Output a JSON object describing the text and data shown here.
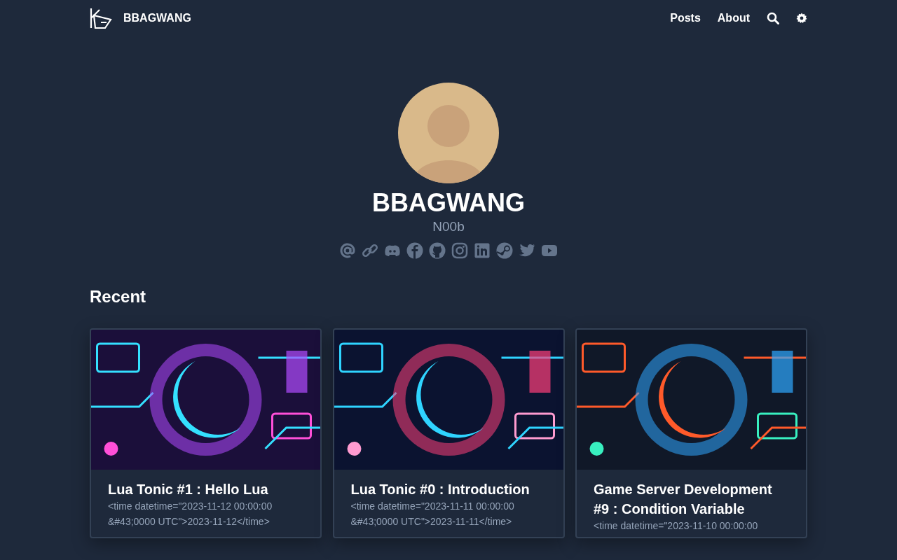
{
  "navbar": {
    "brand": "BBAGWANG",
    "links": [
      "Posts",
      "About"
    ]
  },
  "profile": {
    "name": "BBAGWANG",
    "tagline": "N00b",
    "social_links": [
      {
        "kind": "email"
      },
      {
        "kind": "link"
      },
      {
        "kind": "discord"
      },
      {
        "kind": "facebook"
      },
      {
        "kind": "github"
      },
      {
        "kind": "instagram"
      },
      {
        "kind": "linkedin"
      },
      {
        "kind": "steam"
      },
      {
        "kind": "twitter"
      },
      {
        "kind": "youtube"
      }
    ]
  },
  "recent": {
    "heading": "Recent",
    "posts": [
      {
        "title": "Lua Tonic #1 : Hello Lua",
        "date": "<time datetime=\"2023-11-12 00:00:00 &#43;0000 UTC\">2023-11-12</time>"
      },
      {
        "title": "Lua Tonic #0 : Introduction",
        "date": "<time datetime=\"2023-11-11 00:00:00 &#43;0000 UTC\">2023-11-11</time>"
      },
      {
        "title": "Game Server Development #9 : Condition Variable",
        "date": "<time datetime=\"2023-11-10 00:00:00"
      }
    ]
  }
}
